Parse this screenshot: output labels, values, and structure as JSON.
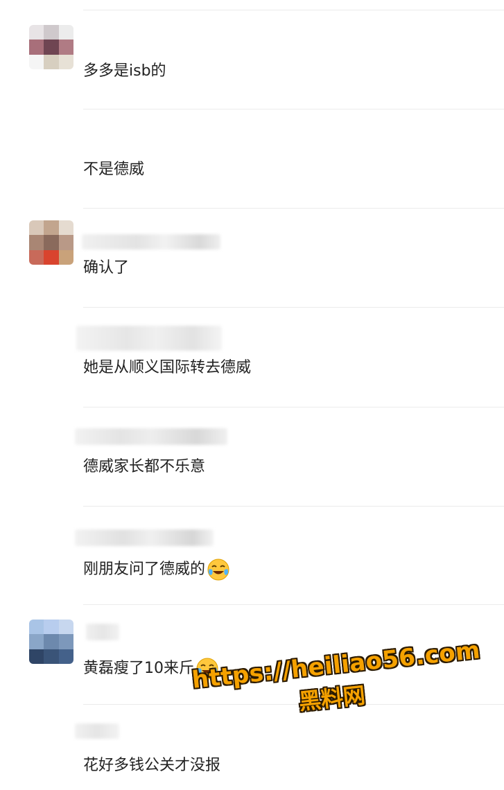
{
  "comments": [
    {
      "text": "多多是isb的"
    },
    {
      "text": "不是德威"
    },
    {
      "text": "确认了"
    },
    {
      "text": "她是从顺义国际转去德威"
    },
    {
      "text": "德威家长都不乐意"
    },
    {
      "text": "刚朋友问了德威的",
      "emoji": "laughing-crying-emoji"
    },
    {
      "text": "黄磊瘦了10来斤",
      "emoji": "laughing-crying-emoji"
    },
    {
      "text": "花好多钱公关才没报"
    }
  ],
  "watermark": {
    "url": "https://heiliao56.com",
    "site_name": "黑料网"
  },
  "colors": {
    "divider": "#ebebeb",
    "text": "#222222",
    "watermark_fill": "#f5a100",
    "watermark_outline": "#2b1a00"
  }
}
